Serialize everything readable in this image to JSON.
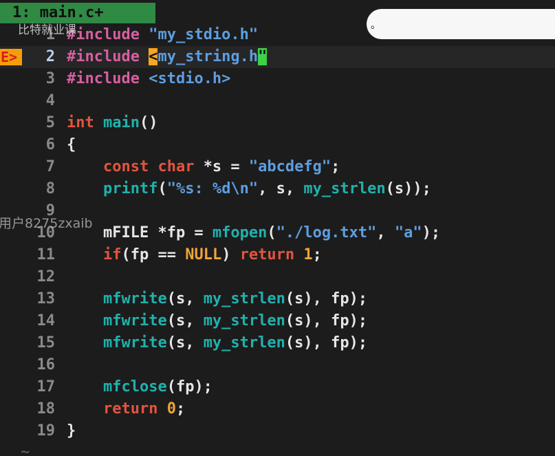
{
  "tab": {
    "label": "1: main.c+"
  },
  "watermarks": {
    "top": "比特就业课",
    "middle": "用户8275zxaib"
  },
  "notification": {
    "text": "。"
  },
  "gutter": {
    "error_sign": "E>"
  },
  "eof": {
    "tilde": "~"
  },
  "lines": [
    {
      "n": "1",
      "t": [
        [
          "pp",
          "#include "
        ],
        [
          "str",
          "\"my_stdio.h\""
        ]
      ]
    },
    {
      "n": "2",
      "t": [
        [
          "pp",
          "#include "
        ],
        [
          "hl-o",
          "<"
        ],
        [
          "str",
          "my_string.h"
        ],
        [
          "hl-g",
          "\""
        ]
      ]
    },
    {
      "n": "3",
      "t": [
        [
          "pp",
          "#include "
        ],
        [
          "str",
          "<stdio.h>"
        ]
      ]
    },
    {
      "n": "4",
      "t": []
    },
    {
      "n": "5",
      "t": [
        [
          "kw",
          "int "
        ],
        [
          "fn",
          "main"
        ],
        [
          "pl",
          "()"
        ]
      ]
    },
    {
      "n": "6",
      "t": [
        [
          "pl",
          "{"
        ]
      ]
    },
    {
      "n": "7",
      "t": [
        [
          "pl",
          "    "
        ],
        [
          "kw",
          "const char "
        ],
        [
          "pl",
          "*s = "
        ],
        [
          "str",
          "\"abcdefg\""
        ],
        [
          "pl",
          ";"
        ]
      ]
    },
    {
      "n": "8",
      "t": [
        [
          "pl",
          "    "
        ],
        [
          "fn",
          "printf"
        ],
        [
          "pl",
          "("
        ],
        [
          "str",
          "\"%s: %d\\n\""
        ],
        [
          "pl",
          ", s, "
        ],
        [
          "fn",
          "my_strlen"
        ],
        [
          "pl",
          "(s));"
        ]
      ]
    },
    {
      "n": "9",
      "t": []
    },
    {
      "n": "10",
      "t": [
        [
          "pl",
          "    mFILE *fp = "
        ],
        [
          "fn",
          "mfopen"
        ],
        [
          "pl",
          "("
        ],
        [
          "str",
          "\"./log.txt\""
        ],
        [
          "pl",
          ", "
        ],
        [
          "str",
          "\"a\""
        ],
        [
          "pl",
          ");"
        ]
      ]
    },
    {
      "n": "11",
      "t": [
        [
          "pl",
          "    "
        ],
        [
          "kw",
          "if"
        ],
        [
          "pl",
          "(fp == "
        ],
        [
          "num-lit",
          "NULL"
        ],
        [
          "pl",
          ") "
        ],
        [
          "kw",
          "return "
        ],
        [
          "num-lit",
          "1"
        ],
        [
          "pl",
          ";"
        ]
      ]
    },
    {
      "n": "12",
      "t": []
    },
    {
      "n": "13",
      "t": [
        [
          "pl",
          "    "
        ],
        [
          "fn",
          "mfwrite"
        ],
        [
          "pl",
          "(s, "
        ],
        [
          "fn",
          "my_strlen"
        ],
        [
          "pl",
          "(s), fp);"
        ]
      ]
    },
    {
      "n": "14",
      "t": [
        [
          "pl",
          "    "
        ],
        [
          "fn",
          "mfwrite"
        ],
        [
          "pl",
          "(s, "
        ],
        [
          "fn",
          "my_strlen"
        ],
        [
          "pl",
          "(s), fp);"
        ]
      ]
    },
    {
      "n": "15",
      "t": [
        [
          "pl",
          "    "
        ],
        [
          "fn",
          "mfwrite"
        ],
        [
          "pl",
          "(s, "
        ],
        [
          "fn",
          "my_strlen"
        ],
        [
          "pl",
          "(s), fp);"
        ]
      ]
    },
    {
      "n": "16",
      "t": []
    },
    {
      "n": "17",
      "t": [
        [
          "pl",
          "    "
        ],
        [
          "fn",
          "mfclose"
        ],
        [
          "pl",
          "(fp);"
        ]
      ]
    },
    {
      "n": "18",
      "t": [
        [
          "pl",
          "    "
        ],
        [
          "kw",
          "return "
        ],
        [
          "num-lit",
          "0"
        ],
        [
          "pl",
          ";"
        ]
      ]
    },
    {
      "n": "19",
      "t": [
        [
          "pl",
          "}"
        ]
      ]
    }
  ],
  "current_line": "2",
  "colors": {
    "tab_bg": "#2f8a44",
    "background": "#1c1c1c",
    "preprocessor": "#d75fa1",
    "string": "#5d9ee0",
    "keyword": "#e2553f",
    "function": "#1fb2ad",
    "literal": "#f0a53a",
    "error_sign_bg": "#f59e0b",
    "match_open": "#f5a623",
    "match_close": "#3fd147"
  }
}
